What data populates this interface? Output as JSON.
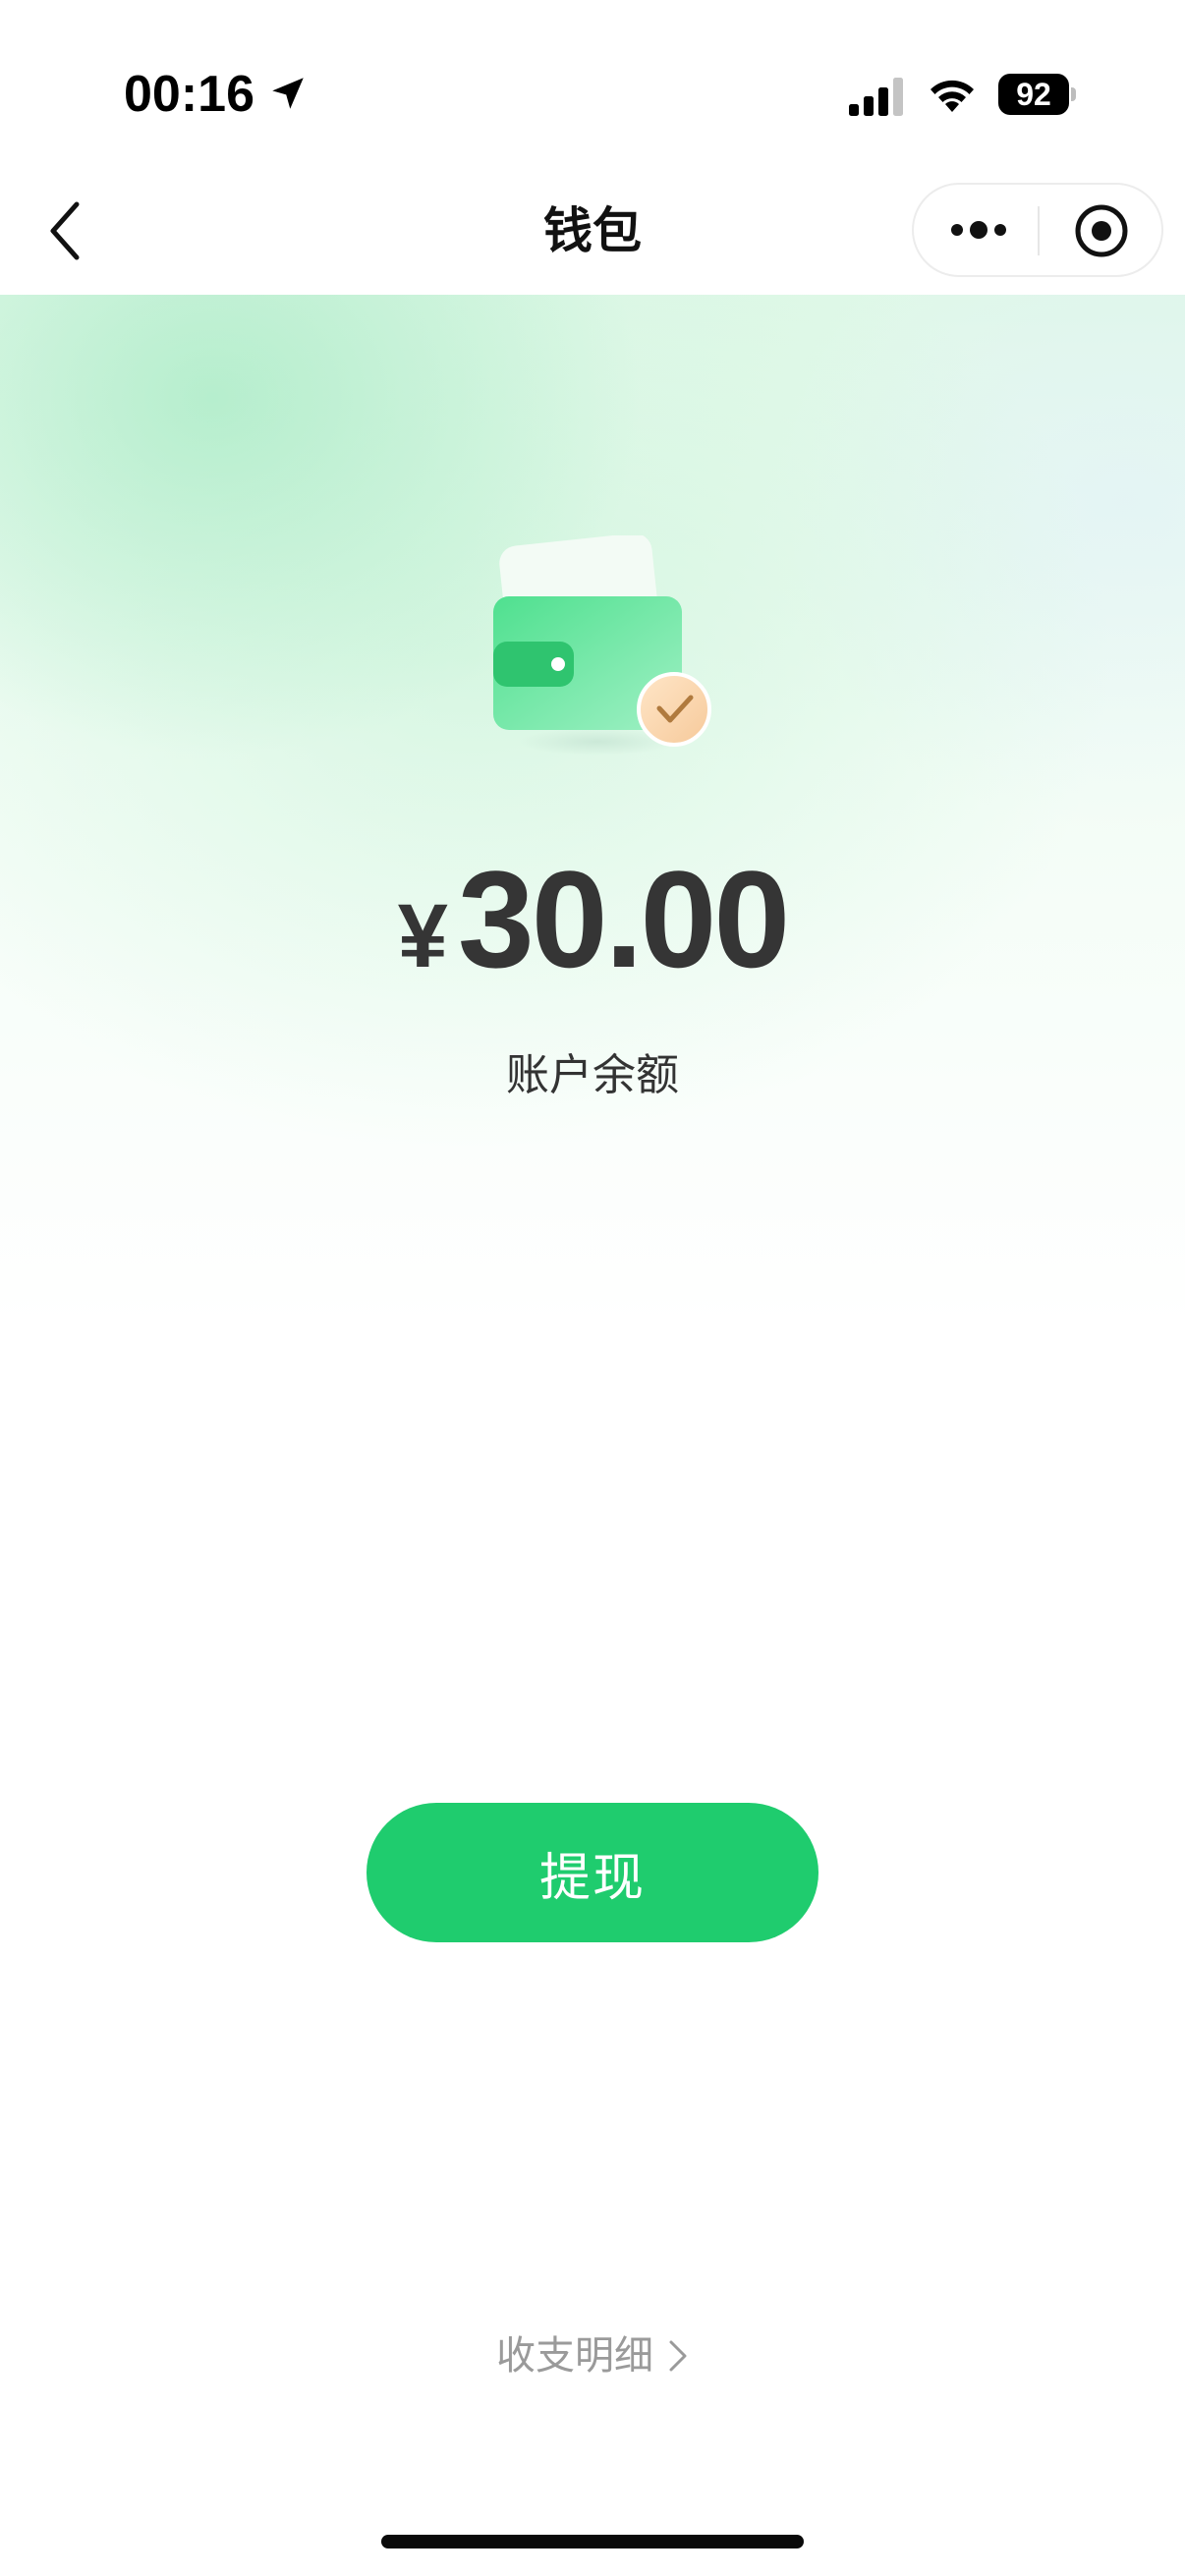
{
  "status_bar": {
    "time": "00:16",
    "battery_level": "92",
    "icons": [
      "location-arrow-icon",
      "cellular-signal-icon",
      "wifi-icon",
      "battery-icon"
    ]
  },
  "nav": {
    "title": "钱包",
    "back_icon": "chevron-left-icon",
    "capsule_icons": [
      "more-dots-icon",
      "close-target-icon"
    ]
  },
  "wallet": {
    "illustration_icon": "wallet-check-icon",
    "currency_symbol": "¥",
    "balance": "30.00",
    "balance_label": "账户余额"
  },
  "actions": {
    "withdraw_label": "提现",
    "details_label": "收支明细",
    "details_icon": "chevron-right-icon"
  },
  "colors": {
    "primary_green": "#1fcc6e",
    "text_dark": "#353535",
    "text_muted": "#9a9a9a",
    "gradient_green": "#c8f2d6"
  }
}
